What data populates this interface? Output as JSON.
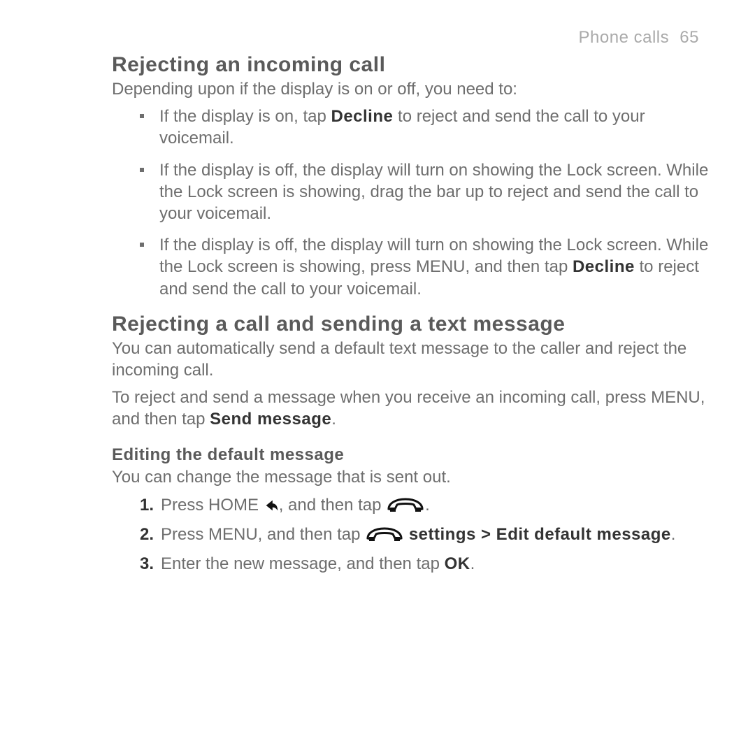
{
  "header": {
    "chapter": "Phone calls",
    "page_number": "65"
  },
  "section1": {
    "title": "Rejecting an incoming call",
    "intro": "Depending upon if the display is on or off, you need to:",
    "bullets": [
      {
        "pre": "If the display is on, tap ",
        "strong": "Decline",
        "post": " to reject and send the call to your voicemail."
      },
      {
        "pre": "If the display is off, the display will turn on showing the Lock screen. While the Lock screen is showing, drag the bar up to reject and send the call to your voicemail.",
        "strong": "",
        "post": ""
      },
      {
        "pre": "If the display is off, the display will turn on showing the Lock screen. While the Lock screen is showing, press MENU, and then tap ",
        "strong": "Decline",
        "post": " to reject and send the call to your voicemail."
      }
    ]
  },
  "section2": {
    "title": "Rejecting a call and sending a text message",
    "p1": "You can automatically send a default text message to the caller and reject the incoming call.",
    "p2_pre": "To reject and send a message when you receive an incoming call, press MENU, and then tap ",
    "p2_strong": "Send message",
    "p2_post": "."
  },
  "subsection": {
    "title": "Editing the default message",
    "intro": "You can change the message that is sent out.",
    "steps": {
      "s1_pre": "Press HOME ",
      "s1_mid": ", and then tap ",
      "s1_post": ".",
      "s2_pre": "Press MENU, and then tap ",
      "s2_strong": "settings > Edit default message",
      "s2_post": ".",
      "s3_pre": "Enter the new message, and then tap ",
      "s3_strong": "OK",
      "s3_post": "."
    }
  }
}
